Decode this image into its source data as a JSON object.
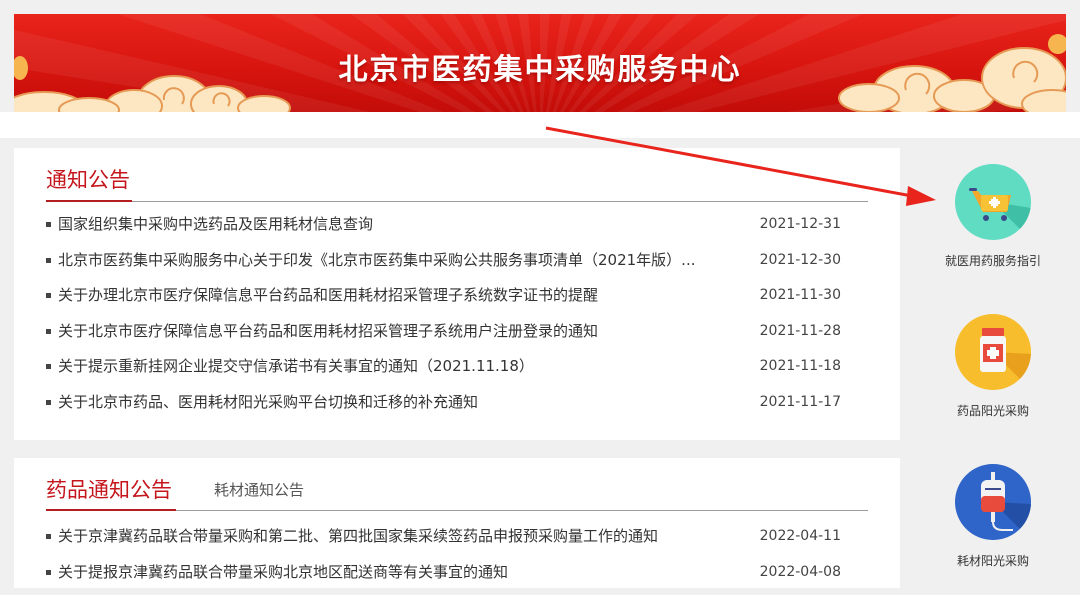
{
  "banner": {
    "title": "北京市医药集中采购服务中心"
  },
  "notice_panel": {
    "title": "通知公告",
    "items": [
      {
        "title": "国家组织集中采购中选药品及医用耗材信息查询",
        "date": "2021-12-31"
      },
      {
        "title": "北京市医药集中采购服务中心关于印发《北京市医药集中采购公共服务事项清单（2021年版）...",
        "date": "2021-12-30"
      },
      {
        "title": "关于办理北京市医疗保障信息平台药品和医用耗材招采管理子系统数字证书的提醒",
        "date": "2021-11-30"
      },
      {
        "title": "关于北京市医疗保障信息平台药品和医用耗材招采管理子系统用户注册登录的通知",
        "date": "2021-11-28"
      },
      {
        "title": "关于提示重新挂网企业提交守信承诺书有关事宜的通知（2021.11.18）",
        "date": "2021-11-18"
      },
      {
        "title": "关于北京市药品、医用耗材阳光采购平台切换和迁移的补充通知",
        "date": "2021-11-17"
      }
    ]
  },
  "drug_panel": {
    "title": "药品通知公告",
    "tab2": "耗材通知公告",
    "items": [
      {
        "title": "关于京津冀药品联合带量采购和第二批、第四批国家集采续签药品申报预采购量工作的通知",
        "date": "2022-04-11"
      },
      {
        "title": "关于提报京津冀药品联合带量采购北京地区配送商等有关事宜的通知",
        "date": "2022-04-08"
      }
    ]
  },
  "services": [
    {
      "label": "就医用药服务指引",
      "icon": "shopping-cart-icon",
      "color": "#5fdcc2"
    },
    {
      "label": "药品阳光采购",
      "icon": "medicine-bottle-icon",
      "color": "#f7bd2c"
    },
    {
      "label": "耗材阳光采购",
      "icon": "iv-bag-icon",
      "color": "#2f64c8"
    }
  ],
  "colors": {
    "accent": "#c4161c",
    "banner": "#d8150f",
    "arrow": "#e8241c"
  }
}
